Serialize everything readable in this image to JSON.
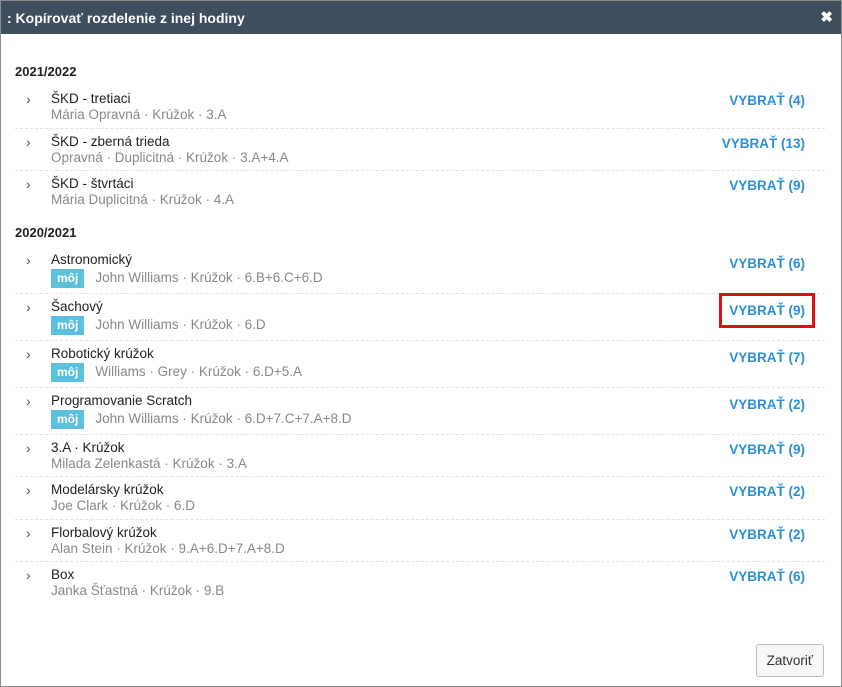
{
  "dialog": {
    "title": ": Kopírovať rozdelenie z inej hodiny",
    "close_glyph": "✖"
  },
  "groups": [
    {
      "year": "2021/2022",
      "items": [
        {
          "name": "ŠKD - tretiaci",
          "sub": "Mária Opravná · Krúžok · 3.A",
          "badge": "",
          "pick": "VYBRAŤ (4)"
        },
        {
          "name": "ŠKD - zberná trieda",
          "sub": "Opravná · Duplicitná · Krúžok · 3.A+4.A",
          "badge": "",
          "pick": "VYBRAŤ (13)"
        },
        {
          "name": "ŠKD - štvrtáci",
          "sub": "Mária Duplicitná · Krúžok · 4.A",
          "badge": "",
          "pick": "VYBRAŤ (9)"
        }
      ]
    },
    {
      "year": "2020/2021",
      "items": [
        {
          "name": "Astronomický",
          "sub": "John Williams · Krúžok · 6.B+6.C+6.D",
          "badge": "môj",
          "pick": "VYBRAŤ (6)"
        },
        {
          "name": "Šachový",
          "sub": "John Williams · Krúžok · 6.D",
          "badge": "môj",
          "pick": "VYBRAŤ (9)"
        },
        {
          "name": "Robotický krúžok",
          "sub": "Williams · Grey · Krúžok · 6.D+5.A",
          "badge": "môj",
          "pick": "VYBRAŤ (7)"
        },
        {
          "name": "Programovanie Scratch",
          "sub": "John Williams · Krúžok · 6.D+7.C+7.A+8.D",
          "badge": "môj",
          "pick": "VYBRAŤ (2)"
        },
        {
          "name": "3.A · Krúžok",
          "sub": "Milada Zelenkastá · Krúžok · 3.A",
          "badge": "",
          "pick": "VYBRAŤ (9)"
        },
        {
          "name": "Modelársky krúžok",
          "sub": "Joe Clark · Krúžok · 6.D",
          "badge": "",
          "pick": "VYBRAŤ (2)"
        },
        {
          "name": "Florbalový krúžok",
          "sub": "Alan Stein · Krúžok · 9.A+6.D+7.A+8.D",
          "badge": "",
          "pick": "VYBRAŤ (2)"
        },
        {
          "name": "Box",
          "sub": "Janka Šťastná · Krúžok · 9.B",
          "badge": "",
          "pick": "VYBRAŤ (6)"
        }
      ]
    }
  ],
  "highlighted": {
    "group": 1,
    "item": 1
  },
  "footer": {
    "close_button": "Zatvoriť"
  }
}
